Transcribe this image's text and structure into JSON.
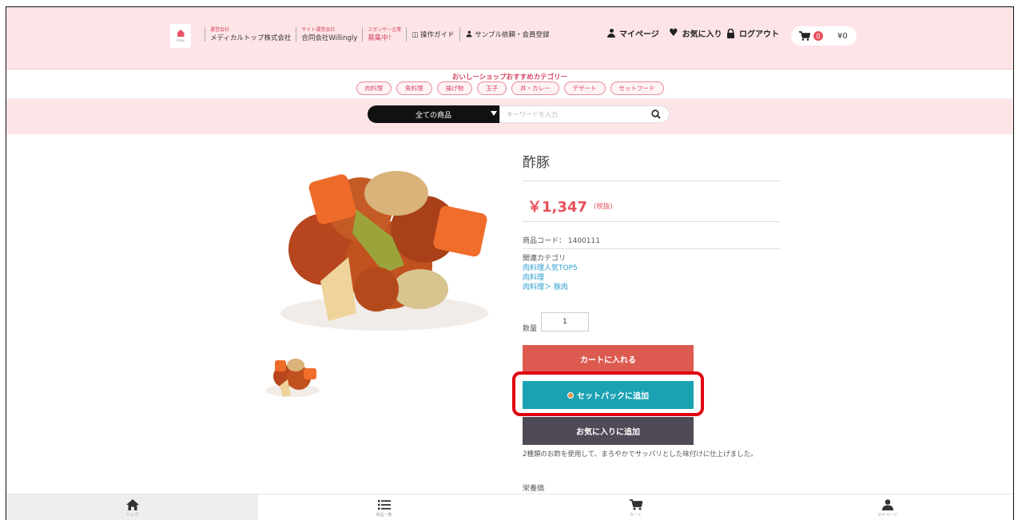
{
  "header": {
    "corp1_small": "運営会社",
    "corp1_name": "メディカルトップ株式会社",
    "corp2_small": "サイト運営会社",
    "corp2_name": "合同会社Willingly",
    "sponsor_small": "スポンサー企業",
    "sponsor_text": "募集中！",
    "guide": "操作ガイド",
    "sample": "サンプル依頼・会員登録",
    "mypage": "マイページ",
    "favorites": "お気に入り",
    "logout": "ログアウト",
    "cart_count": "0",
    "cart_total": "¥0"
  },
  "categories": {
    "title": "おいしーショップおすすめカテゴリー",
    "items": [
      "肉料理",
      "魚料理",
      "揚げ物",
      "玉子",
      "丼・カレー",
      "デザート",
      "セットフード"
    ]
  },
  "search": {
    "select_value": "全ての商品",
    "placeholder": "キーワードを入力"
  },
  "product": {
    "title": "酢豚",
    "price": "￥1,347",
    "tax": "(税抜)",
    "code": "商品コード： 1400111",
    "related_label": "関連カテゴリ",
    "related_links": [
      "肉料理人気TOP5",
      "肉料理",
      "肉料理＞ 豚肉"
    ],
    "qty_label": "数量",
    "qty_value": "1",
    "add_to_cart": "カートに入れる",
    "add_to_set": "セットパックに追加",
    "add_to_fav": "お気に入りに追加",
    "description": "2種類のお酢を使用して、まろやかでサッパリとした味付けに仕上げました。",
    "nutrition_label": "栄養価"
  },
  "bottom_nav": [
    {
      "label": "トップ"
    },
    {
      "label": "商品一覧"
    },
    {
      "label": "カート"
    },
    {
      "label": "マイページ"
    }
  ],
  "colors": {
    "header_bg": "#fde5e7",
    "price": "#e8505b",
    "cart_button": "#dc5a4f",
    "set_button": "#1aa2b3",
    "fav_button": "#4f4a56",
    "highlight": "#e0000f"
  }
}
